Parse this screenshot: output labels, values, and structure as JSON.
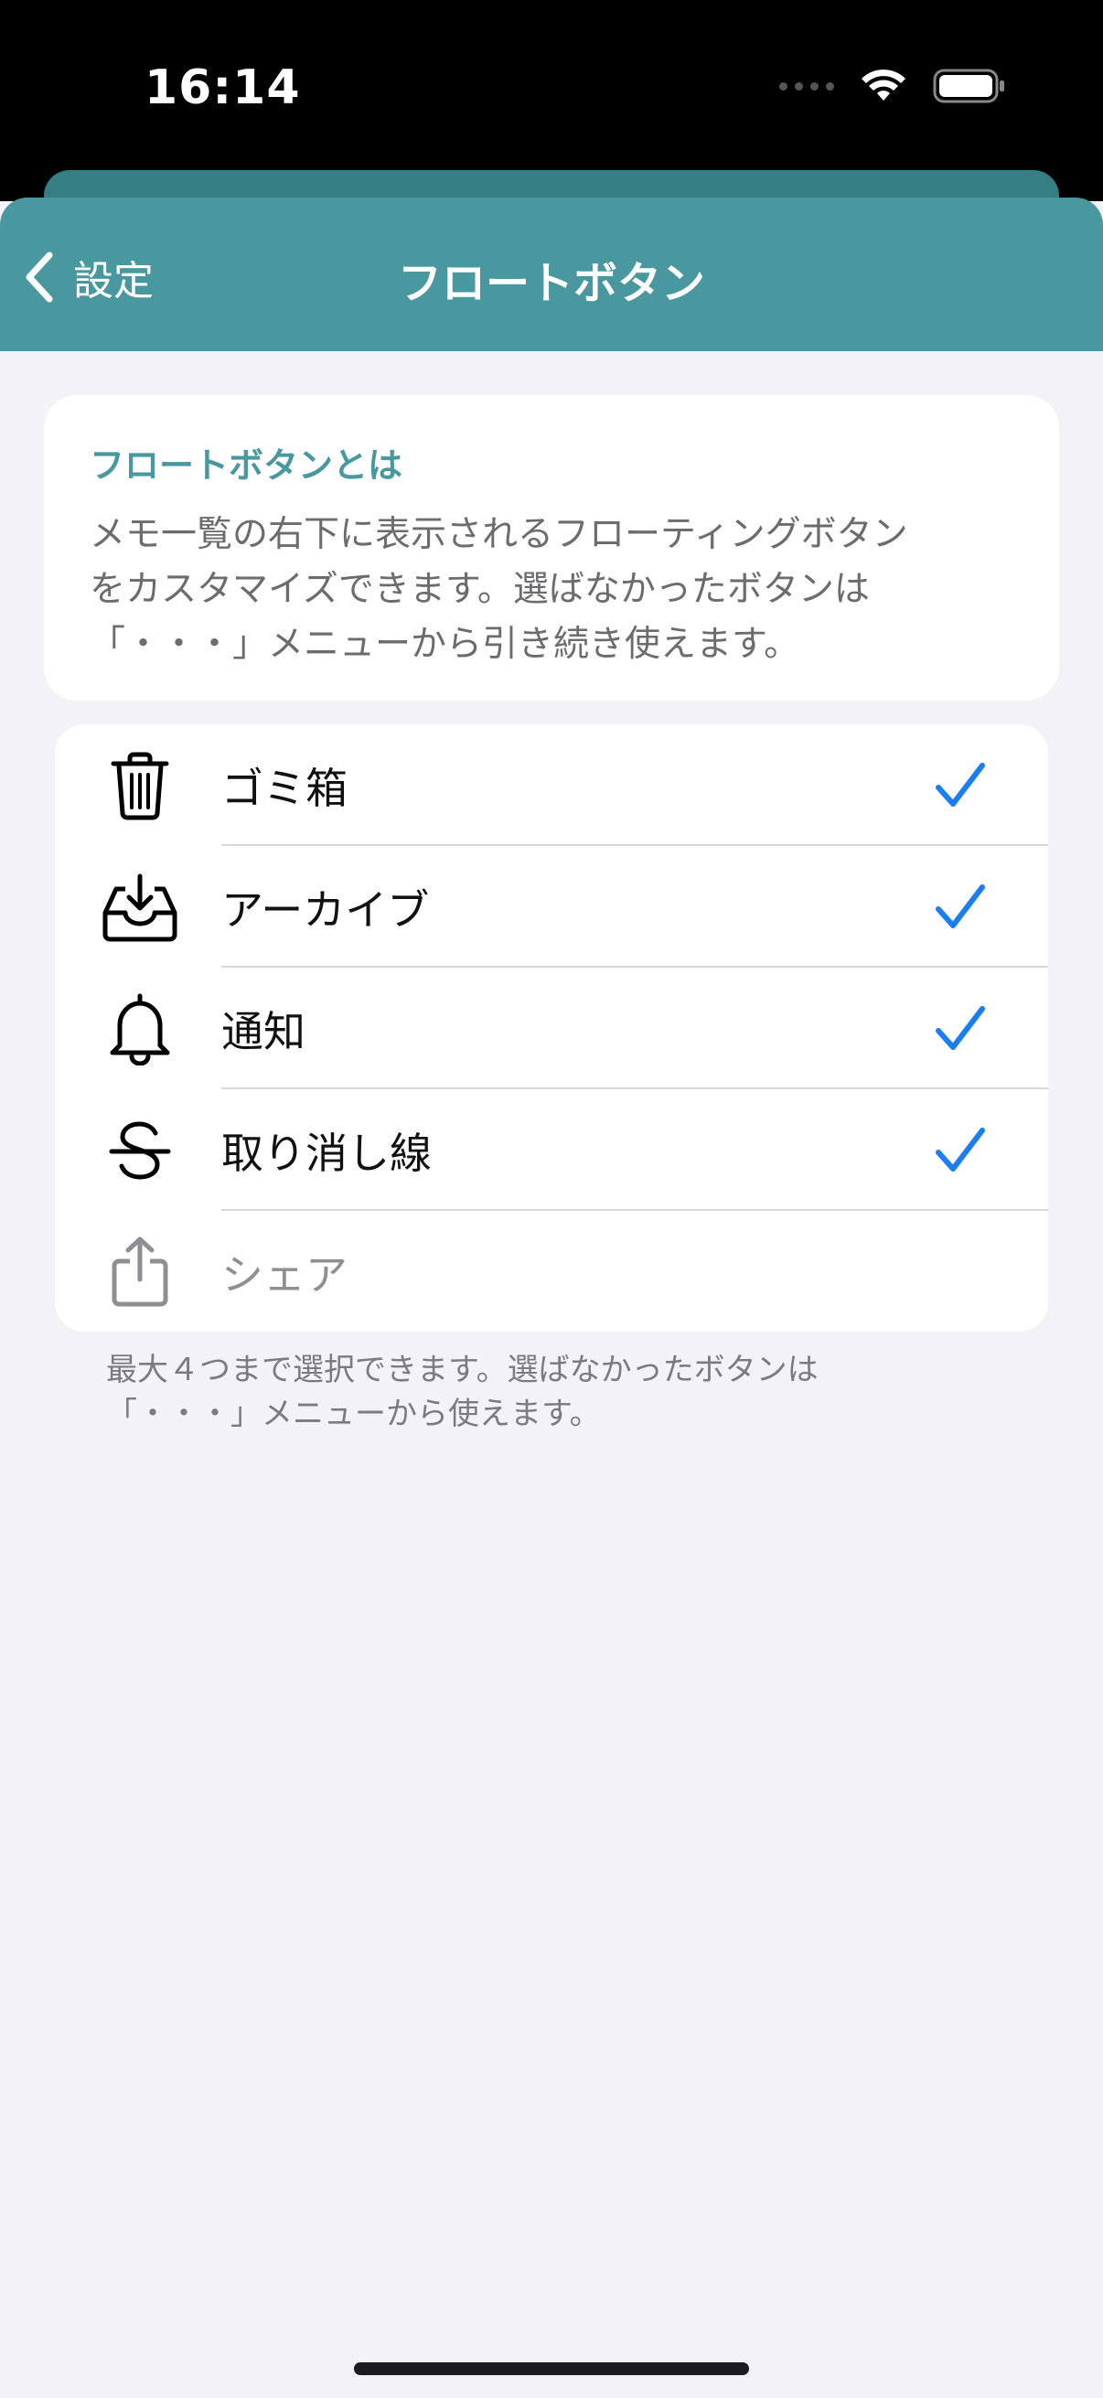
{
  "status_bar": {
    "time": "16:14",
    "icons": [
      "signal-dots-icon",
      "wifi-icon",
      "battery-icon"
    ]
  },
  "nav": {
    "back_label": "設定",
    "title": "フロートボタン",
    "color": "#4a989f"
  },
  "info": {
    "title": "フロートボタンとは",
    "lines": [
      "メモ一覧の右下に表示されるフローティングボタン",
      "をカスタマイズできます。選ばなかったボタンは",
      "「・・・」メニューから引き続き使えます。"
    ]
  },
  "options": [
    {
      "label": "ゴミ箱",
      "icon": "trash-icon",
      "checked": true
    },
    {
      "label": "アーカイブ",
      "icon": "archive-tray-icon",
      "checked": true
    },
    {
      "label": "通知",
      "icon": "bell-icon",
      "checked": true
    },
    {
      "label": "取り消し線",
      "icon": "strikethrough-icon",
      "checked": true
    },
    {
      "label": "シェア",
      "icon": "share-icon",
      "checked": false
    }
  ],
  "footnote": {
    "lines": [
      "最大４つまで選択できます。選ばなかったボタンは",
      "「・・・」メニューから使えます。"
    ]
  },
  "colors": {
    "check": "#1a7ef0",
    "background": "#f2f2f7"
  }
}
